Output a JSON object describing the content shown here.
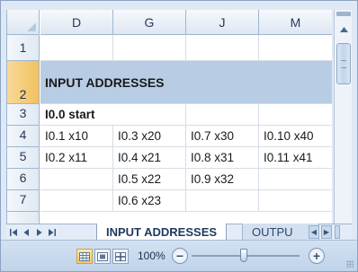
{
  "columns": [
    "D",
    "G",
    "J",
    "M"
  ],
  "rows": [
    {
      "num": "1",
      "cells": [
        "",
        "",
        "",
        ""
      ]
    },
    {
      "num": "2",
      "banner": "INPUT ADDRESSES"
    },
    {
      "num": "3",
      "cells": [
        "I0.0  start",
        "",
        "",
        ""
      ]
    },
    {
      "num": "4",
      "cells": [
        "I0.1  x10",
        "I0.3  x20",
        "I0.7  x30",
        "I0.10  x40"
      ]
    },
    {
      "num": "5",
      "cells": [
        "I0.2  x11",
        "I0.4  x21",
        "I0.8  x31",
        "I0.11  x41"
      ]
    },
    {
      "num": "6",
      "cells": [
        "",
        "I0.5  x22",
        "I0.9  x32",
        ""
      ]
    },
    {
      "num": "7",
      "cells": [
        "",
        "I0.6  x23",
        "",
        ""
      ]
    }
  ],
  "sheet_tabs": {
    "active": "INPUT ADDRESSES",
    "next": "OUTPU"
  },
  "status_bar": {
    "zoom_label": "100%",
    "zoom_percent": 100,
    "zoom_out": "−",
    "zoom_in": "+"
  },
  "colors": {
    "banner_fill": "#b8cce4",
    "selected_row_header": "#f1c15f",
    "header_text": "#2a3a55"
  },
  "icons": [
    "first-sheet-icon",
    "prev-sheet-icon",
    "next-sheet-icon",
    "last-sheet-icon",
    "normal-view-icon",
    "page-layout-view-icon",
    "page-break-view-icon",
    "scroll-up-icon",
    "resize-grip-icon"
  ]
}
